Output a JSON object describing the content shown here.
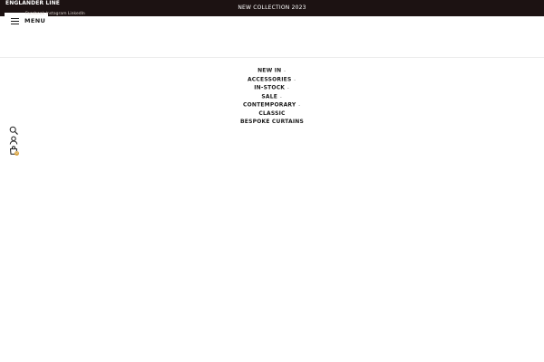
{
  "topbar": {
    "brand": "ENGLANDER LINE",
    "social": "Facebook Instagram LinkedIn",
    "announcement": "NEW COLLECTION 2023",
    "background": "#1c1212"
  },
  "header": {
    "menu_label": "MENU",
    "menu_icon": "hamburger-icon"
  },
  "nav": {
    "items": [
      {
        "label": "NEW IN",
        "has_dropdown": true
      },
      {
        "label": "ACCESSORIES",
        "has_dropdown": true
      },
      {
        "label": "IN-STOCK",
        "has_dropdown": true
      },
      {
        "label": "SALE",
        "has_dropdown": true
      },
      {
        "label": "CONTEMPORARY",
        "has_dropdown": true
      },
      {
        "label": "CLASSIC",
        "has_dropdown": false
      },
      {
        "label": "BESPOKE CURTAINS",
        "has_dropdown": false
      }
    ],
    "chevron_glyph": "⌄"
  },
  "actions": {
    "search_icon": "search-icon",
    "account_icon": "user-icon",
    "cart_icon": "shopping-bag-icon",
    "cart_count": "0",
    "badge_color": "#d9a441"
  }
}
